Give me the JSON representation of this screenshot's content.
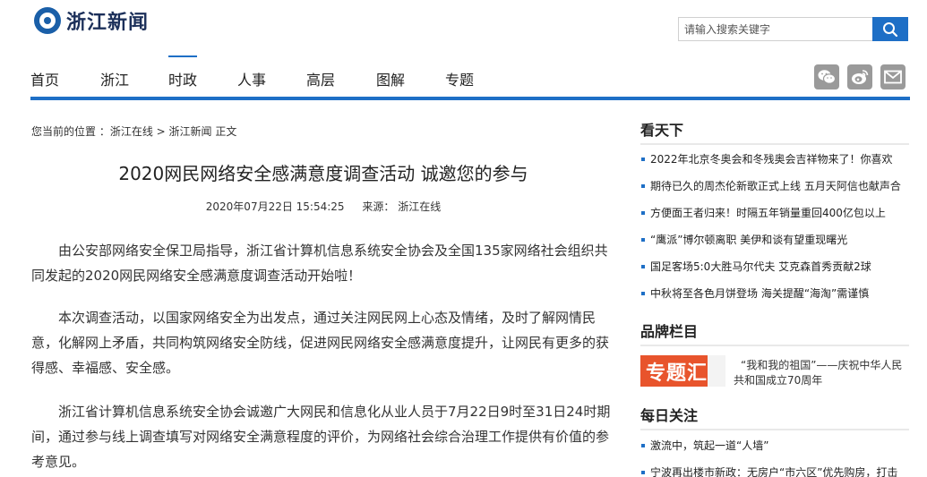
{
  "header": {
    "site_name": "浙江新闻",
    "search_placeholder": "请输入搜索关键字"
  },
  "nav": {
    "items": [
      "首页",
      "浙江",
      "时政",
      "人事",
      "高层",
      "图解",
      "专题"
    ],
    "active": "时政"
  },
  "share_icons": [
    "wechat-icon",
    "weibo-icon",
    "email-icon"
  ],
  "colors": {
    "accent": "#1e6fc6",
    "brand_orange": "#e8542c",
    "icon_gray": "#9a9a9a"
  },
  "breadcrumb": {
    "prefix": "您当前的位置 ：",
    "site": "浙江在线",
    "sep": " > ",
    "section": "浙江新闻",
    "current": " 正文"
  },
  "article": {
    "title": "2020网民网络安全感满意度调查活动 诚邀您的参与",
    "datetime": "2020年07月22日 15:54:25",
    "source": "来源： 浙江在线",
    "paragraphs": [
      "由公安部网络安全保卫局指导，浙江省计算机信息系统安全协会及全国135家网络社会组织共同发起的2020网民网络安全感满意度调查活动开始啦！",
      "本次调查活动，以国家网络安全为出发点，通过关注网民网上心态及情绪，及时了解网情民意，化解网上矛盾，共同构筑网络安全防线，促进网民网络安全感满意度提升，让网民有更多的获得感、幸福感、安全感。",
      "浙江省计算机信息系统安全协会诚邀广大网民和信息化从业人员于7月22日9时至31日24时期间，通过参与线上调查填写对网络安全满意程度的评价，为网络社会综合治理工作提供有价值的参考意见。"
    ]
  },
  "sidebar": {
    "world": {
      "title": "看天下",
      "items": [
        "2022年北京冬奥会和冬残奥会吉祥物来了！你喜欢",
        "期待已久的周杰伦新歌正式上线 五月天阿信也献声合",
        "方便面王者归来！时隔五年销量重回400亿包以上",
        "“鹰派”博尔顿离职 美伊和谈有望重现曙光",
        "国足客场5:0大胜马尔代夫 艾克森首秀贡献2球",
        "中秋将至各色月饼登场 海关提醒“海淘”需谨慎"
      ]
    },
    "brand": {
      "title": "品牌栏目",
      "image_text": "专题汇",
      "text": "“我和我的祖国”——庆祝中华人民共和国成立70周年"
    },
    "daily": {
      "title": "每日关注",
      "items": [
        "激流中，筑起一道“人墙”",
        "宁波再出楼市新政：无房户“市六区”优先购房，打击"
      ]
    }
  }
}
